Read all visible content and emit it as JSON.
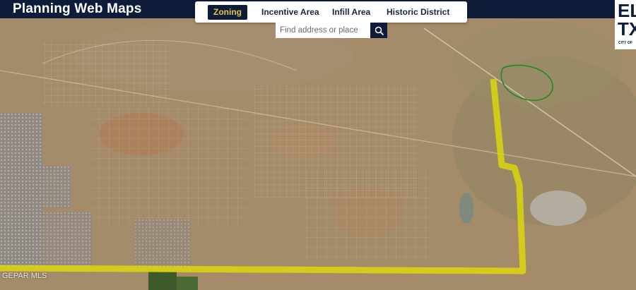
{
  "header": {
    "app_title": "Planning Web Maps"
  },
  "tabs": [
    {
      "label": "Zoning",
      "active": true
    },
    {
      "label": "Incentive Area",
      "active": false
    },
    {
      "label": "Infill Area",
      "active": false
    },
    {
      "label": "Historic District",
      "active": false
    }
  ],
  "search": {
    "placeholder": "Find address or place",
    "value": "",
    "icon": "search-icon"
  },
  "logo": {
    "line1": "EL",
    "line2": "TX",
    "sub": "CITY OF"
  },
  "watermark": "GEPAR MLS",
  "colors": {
    "header_bg": "#0e1c3a",
    "active_tab_text": "#e8c64a",
    "boundary_highlight": "#e6e000",
    "area_outline": "#1f8a1f"
  }
}
